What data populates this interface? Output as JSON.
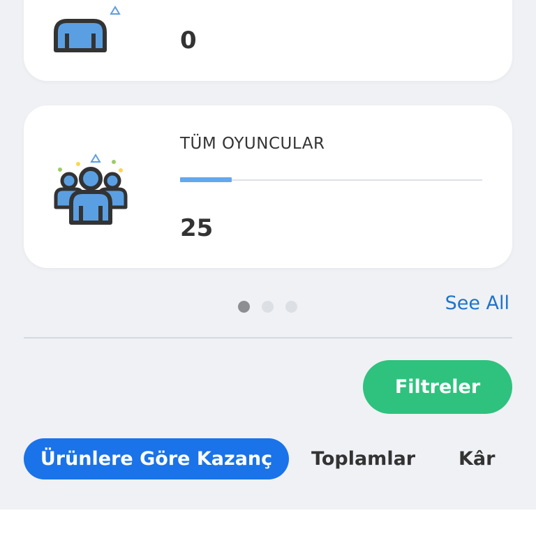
{
  "cards": [
    {
      "value": "0",
      "icon": "user-icon"
    },
    {
      "title": "TÜM OYUNCULAR",
      "value": "25",
      "icon": "group-users-icon",
      "progress_fraction": 0.17
    }
  ],
  "pagination": {
    "count": 3,
    "active_index": 0
  },
  "see_all_label": "See All",
  "filter_button_label": "Filtreler",
  "tabs": [
    {
      "label": "Ürünlere Göre Kazanç",
      "active": true
    },
    {
      "label": "Toplamlar",
      "active": false
    },
    {
      "label": "Kâr",
      "active": false
    }
  ],
  "colors": {
    "background": "#eff1f5",
    "card": "#ffffff",
    "accent_blue": "#1a73e8",
    "link_blue": "#1f73c9",
    "progress_blue": "#63a8ee",
    "filter_green": "#2ec27e",
    "icon_blue": "#5b9fe3",
    "icon_outline": "#333333"
  }
}
